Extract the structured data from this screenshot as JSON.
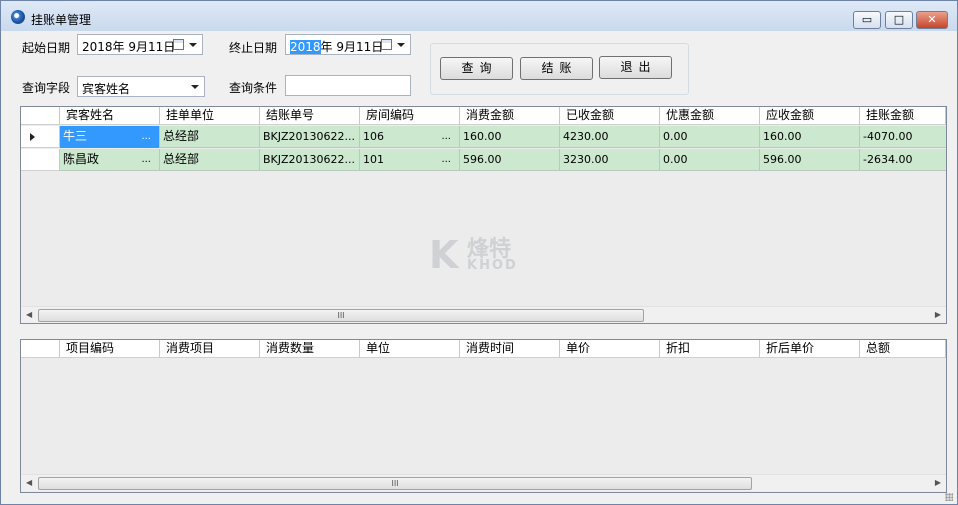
{
  "window": {
    "title": "挂账单管理",
    "controls": {
      "minimize": "▭",
      "maximize": "□",
      "close": "✕"
    }
  },
  "filters": {
    "start_date_label": "起始日期",
    "start_date_value": "2018年  9月11日",
    "end_date_label": "终止日期",
    "end_date_year": "2018",
    "end_date_rest": "年  9月11日",
    "query_field_label": "查询字段",
    "query_field_value": "宾客姓名",
    "query_condition_label": "查询条件",
    "query_condition_value": ""
  },
  "buttons": {
    "query": "查询",
    "checkout": "结账",
    "exit": "退出"
  },
  "main_grid": {
    "columns": [
      "宾客姓名",
      "挂单单位",
      "结账单号",
      "房间编码",
      "消费金额",
      "已收金额",
      "优惠金额",
      "应收金额",
      "挂账金额"
    ],
    "rows": [
      {
        "guest": "牛三",
        "unit": "总经部",
        "bill_no": "BKJZ20130622...",
        "room": "106",
        "consume": "160.00",
        "received": "4230.00",
        "discount": "0.00",
        "receivable": "160.00",
        "hang": "-4070.00"
      },
      {
        "guest": "陈昌政",
        "unit": "总经部",
        "bill_no": "BKJZ20130622...",
        "room": "101",
        "consume": "596.00",
        "received": "3230.00",
        "discount": "0.00",
        "receivable": "596.00",
        "hang": "-2634.00"
      }
    ],
    "ellipsis": "...",
    "scroll_grip": "III"
  },
  "detail_grid": {
    "columns": [
      "项目编码",
      "消费项目",
      "消费数量",
      "单位",
      "消费时间",
      "单价",
      "折扣",
      "折后单价",
      "总额"
    ],
    "scroll_grip": "III"
  },
  "watermark": {
    "letter": "K",
    "cn": "烽特",
    "en": "KHOD"
  },
  "colors": {
    "row_bg": "#cce8cf",
    "selection": "#3399ff"
  }
}
